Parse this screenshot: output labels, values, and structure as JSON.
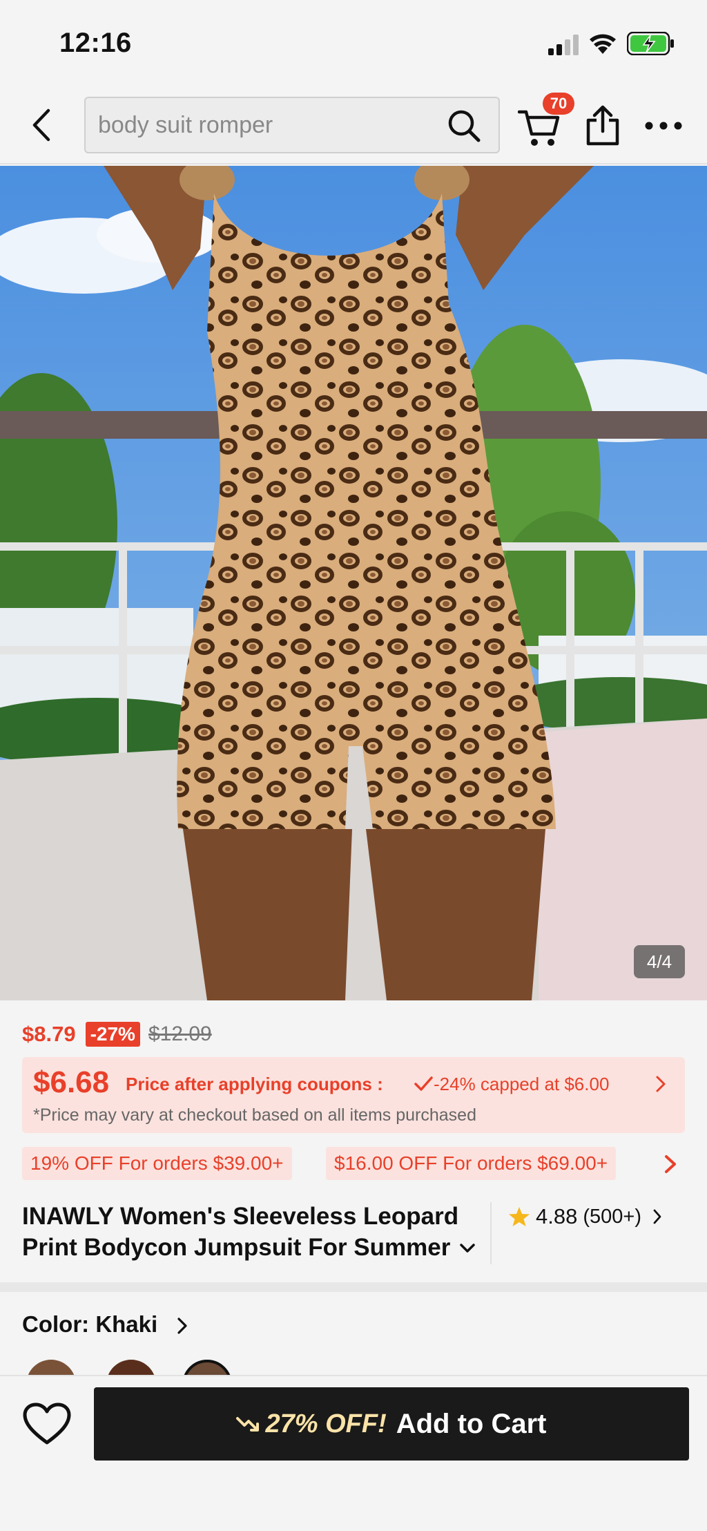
{
  "status_bar": {
    "time": "12:16",
    "icons": [
      "signal-icon",
      "wifi-icon",
      "battery-charging-icon"
    ]
  },
  "nav": {
    "back_icon": "chevron-left-icon",
    "search_placeholder": "body suit romper",
    "search_icon": "search-icon",
    "cart_icon": "cart-icon",
    "cart_count": "70",
    "share_icon": "share-icon",
    "more_icon": "more-icon"
  },
  "gallery": {
    "counter": "4/4"
  },
  "price": {
    "current": "$8.79",
    "discount": "-27%",
    "original": "$12.09"
  },
  "coupon": {
    "price": "$6.68",
    "label": "Price after applying coupons :",
    "cap": "-24% capped at $6.00",
    "note": "*Price may vary at checkout based on all items purchased"
  },
  "offers": [
    "19% OFF For orders $39.00+",
    "$16.00 OFF For orders $69.00+"
  ],
  "product": {
    "title": "INAWLY Women's Sleeveless Leopard Print Bodycon Jumpsuit For Summer",
    "rating": "4.88",
    "rating_count": "(500+)"
  },
  "color": {
    "label": "Color: Khaki",
    "selected_index": 2
  },
  "bottom_bar": {
    "wishlist_icon": "heart-icon",
    "promo": "27% OFF!",
    "add_to_cart": "Add to Cart"
  },
  "colors": {
    "accent": "#e8402a",
    "coupon_bg": "#fbe2de",
    "cta_bg": "#1a1a1a",
    "promo_text": "#fbe3a8"
  }
}
